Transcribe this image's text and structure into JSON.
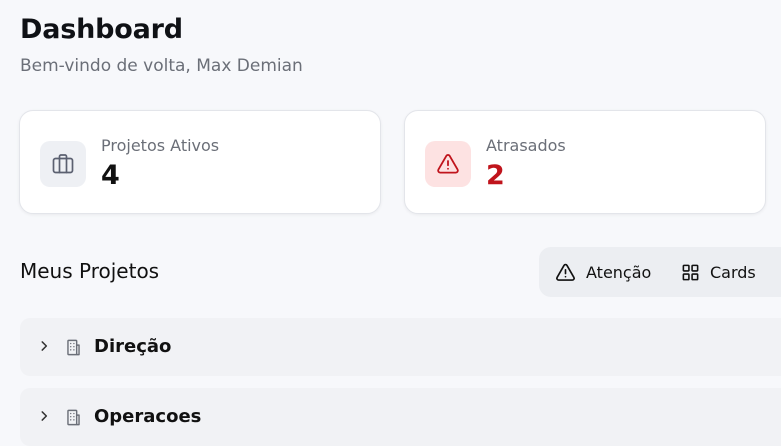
{
  "header": {
    "title": "Dashboard",
    "subtitle": "Bem-vindo de volta, Max Demian"
  },
  "stats": [
    {
      "label": "Projetos Ativos",
      "value": "4",
      "icon": "briefcase-icon",
      "value_color": "#111111"
    },
    {
      "label": "Atrasados",
      "value": "2",
      "icon": "warning-triangle-icon",
      "value_color": "#c0141c"
    }
  ],
  "projects_section": {
    "title": "Meus Projetos",
    "toolbar": {
      "attention_label": "Atenção",
      "attention_icon": "warning-triangle-icon",
      "cards_label": "Cards",
      "cards_icon": "grid-icon"
    },
    "groups": [
      {
        "label": "Direção",
        "icon": "building-icon",
        "expanded": false
      },
      {
        "label": "Operacoes",
        "icon": "building-icon",
        "expanded": false
      }
    ]
  },
  "colors": {
    "background": "#f7f8fb",
    "danger": "#c0141c",
    "danger_bg": "#fde2e2",
    "neutral_icon_bg": "#eef0f4"
  }
}
